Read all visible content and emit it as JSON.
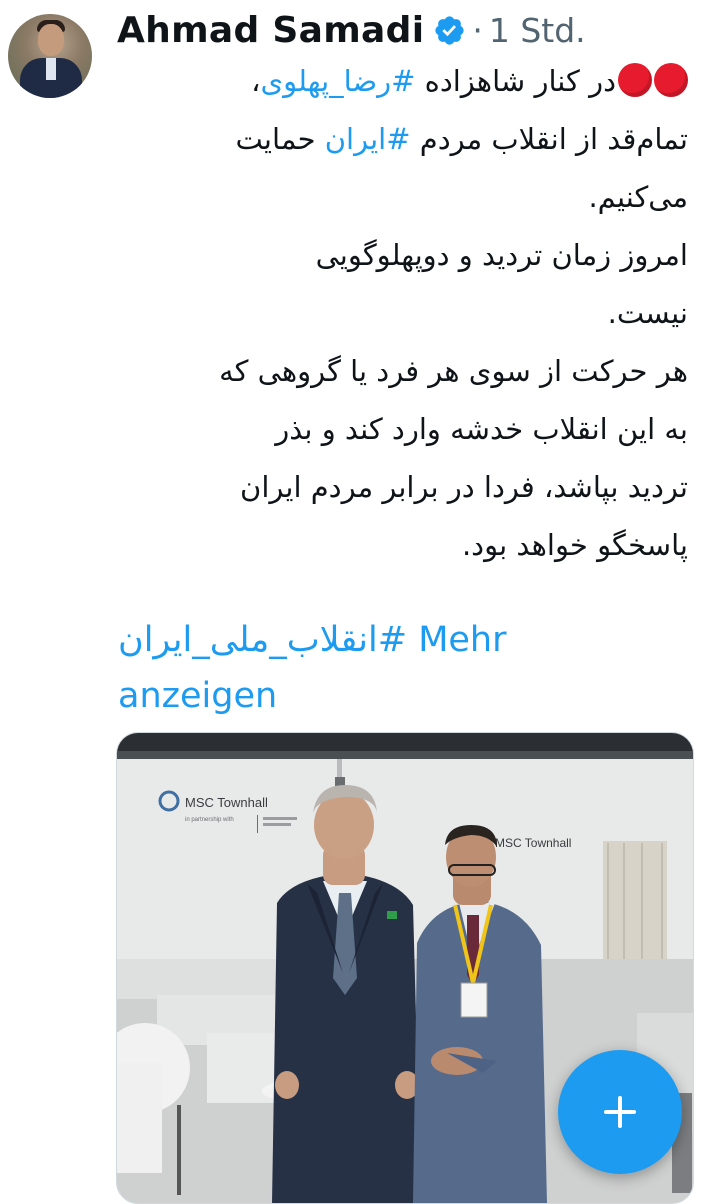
{
  "tweet": {
    "author_name": "Ahmad Samadi",
    "separator": "·",
    "time": "1 Std.",
    "text_lines": [
      {
        "hashtag_before_text": "در کنار شاهزاده ",
        "hashtag": "#رضا_پهلوی",
        "after": "،"
      },
      {
        "before": "تمام‌قد از انقلاب مردم ",
        "hashtag": "#ایران",
        "after": " حمایت"
      },
      {
        "text": "می‌کنیم."
      },
      {
        "text": "امروز زمان تردید و دوپهلوگویی"
      },
      {
        "text": "نیست."
      },
      {
        "text": "هر حرکت از سوی هر فرد یا گروهی که"
      },
      {
        "text": "به این انقلاب خدشه وارد کند و بذر"
      },
      {
        "text": "تردید بپاشد، فردا در برابر مردم ایران"
      },
      {
        "text": "پاسخگو خواهد بود."
      }
    ],
    "bottom_hashtag": "#انقلاب_ملی_ایران",
    "show_more": "Mehr",
    "show_more_2": "anzeigen"
  },
  "media": {
    "sign_left": "MSC Townhall",
    "sign_left_sub": "in partnership with",
    "sign_right": "MSC Townhall"
  },
  "icons": {
    "verified": "verified-badge-icon",
    "plus": "plus-icon",
    "red_dot": "red-circle-emoji-icon"
  },
  "colors": {
    "link": "#1d9bf0",
    "text": "#0f1419",
    "muted": "#536471",
    "fab": "#1d9bf0"
  }
}
